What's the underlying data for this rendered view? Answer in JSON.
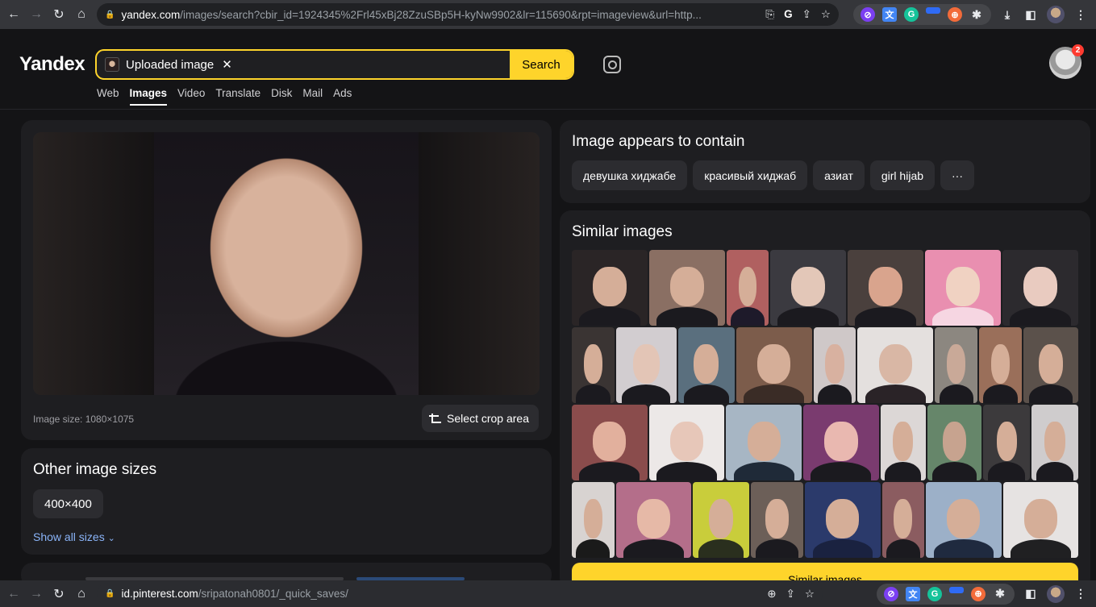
{
  "browser_top": {
    "url_domain": "yandex.com",
    "url_path": "/images/search?cbir_id=1924345%2Frl45xBj28ZzuSBp5H-kyNw9902&lr=115690&rpt=imageview&url=http..."
  },
  "browser_bottom": {
    "url_domain": "id.pinterest.com",
    "url_path": "/sripatonah0801/_quick_saves/"
  },
  "header": {
    "logo": "Yandex",
    "search_chip_label": "Uploaded image",
    "search_button": "Search",
    "notification_count": "2",
    "tabs": [
      {
        "label": "Web"
      },
      {
        "label": "Images"
      },
      {
        "label": "Video"
      },
      {
        "label": "Translate"
      },
      {
        "label": "Disk"
      },
      {
        "label": "Mail"
      },
      {
        "label": "Ads"
      }
    ]
  },
  "main": {
    "image_size": "Image size: 1080×1075",
    "crop_button": "Select crop area"
  },
  "other_sizes": {
    "title": "Other image sizes",
    "sizes": [
      "400×400"
    ],
    "show_all": "Show all sizes"
  },
  "contains": {
    "title": "Image appears to contain",
    "tags": [
      "девушка хиджабе",
      "красивый хиджаб",
      "азиат",
      "girl hijab",
      "···"
    ]
  },
  "similar": {
    "title": "Similar images",
    "button_label": "Similar images"
  },
  "colors": {
    "accent": "#fed42b",
    "bg": "#141416",
    "card": "#1e1e21",
    "link": "#8ab4f8"
  }
}
